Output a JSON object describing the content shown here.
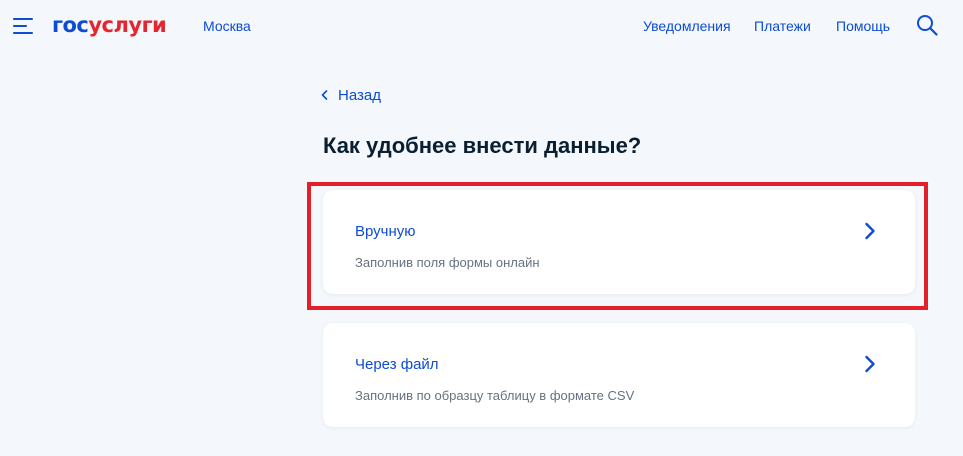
{
  "header": {
    "logo_part1": "гос",
    "logo_part2": "услуги",
    "city": "Москва",
    "nav": [
      "Уведомления",
      "Платежи",
      "Помощь"
    ]
  },
  "back": {
    "label": "Назад"
  },
  "page_title": "Как удобнее внести данные?",
  "options": [
    {
      "title": "Вручную",
      "description": "Заполнив поля формы онлайн"
    },
    {
      "title": "Через файл",
      "description": "Заполнив по образцу таблицу в формате CSV"
    }
  ],
  "colors": {
    "accent": "#0d4cd3",
    "brand_red": "#e3262f",
    "highlight": "#e2202a",
    "background": "#f4f7fb"
  },
  "icons": {
    "menu": "hamburger-menu-icon",
    "search": "search-icon",
    "back": "chevron-left-icon",
    "option": "chevron-right-icon"
  }
}
